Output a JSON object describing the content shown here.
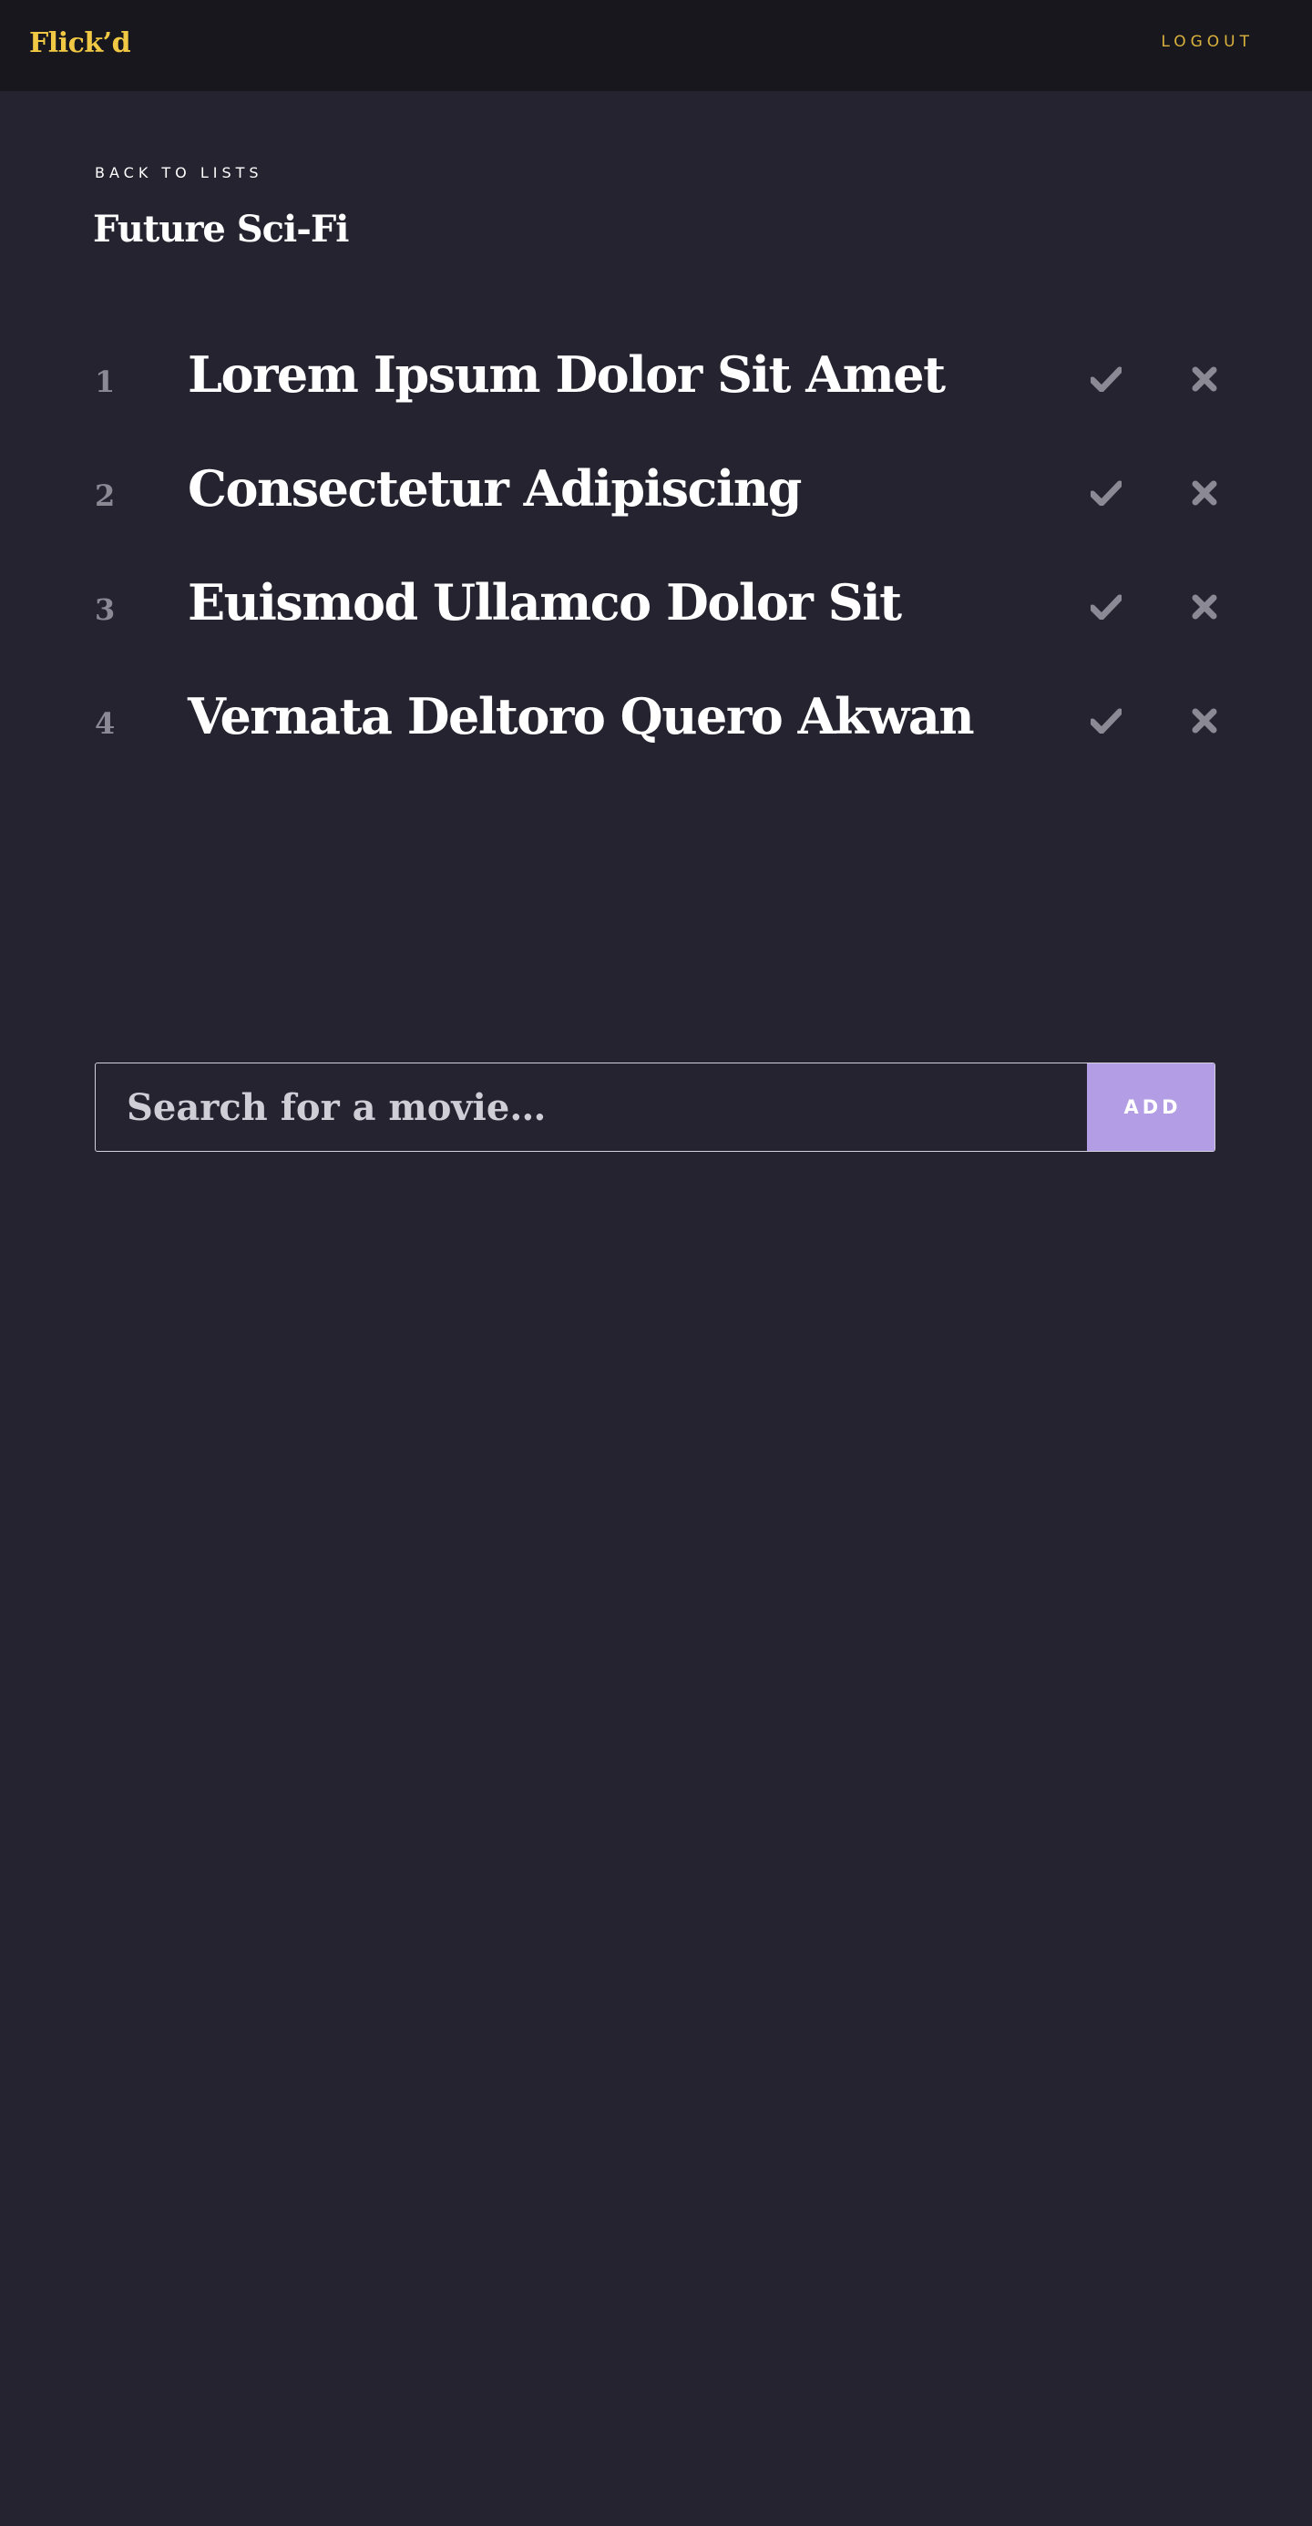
{
  "header": {
    "brand": "Flick’d",
    "logout_label": "LOGOUT"
  },
  "page": {
    "back_label": "BACK TO LISTS",
    "title": "Future Sci-Fi"
  },
  "movies": [
    {
      "number": "1",
      "title": "Lorem Ipsum Dolor Sit Amet"
    },
    {
      "number": "2",
      "title": "Consectetur Adipiscing"
    },
    {
      "number": "3",
      "title": "Euismod Ullamco Dolor Sit"
    },
    {
      "number": "4",
      "title": "Vernata Deltoro Quero Akwan"
    }
  ],
  "icons": {
    "check": "check-icon",
    "remove": "close-icon"
  },
  "search": {
    "placeholder": "Search for a movie…",
    "value": "",
    "add_label": "ADD"
  },
  "colors": {
    "background": "#24232f",
    "header_background": "#18171e",
    "brand": "#f0c843",
    "logout": "#d9b13d",
    "add_button": "#b39ee6",
    "icon": "#8a8994"
  }
}
